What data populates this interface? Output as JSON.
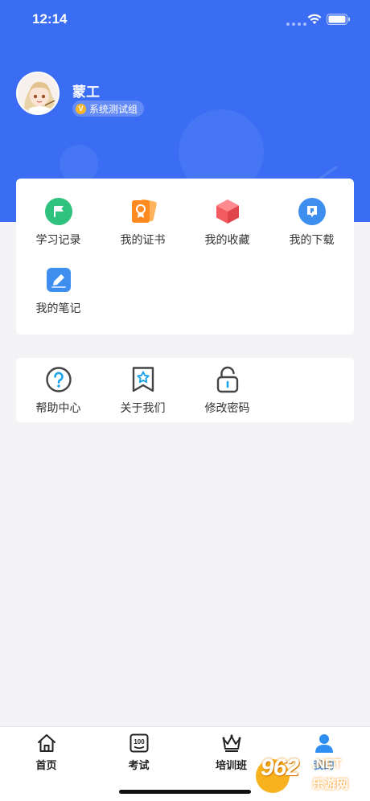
{
  "status_bar": {
    "time": "12:14"
  },
  "profile": {
    "name": "蒙工",
    "badge_icon_letter": "V",
    "badge_text": "系统测试组"
  },
  "shortcuts": [
    {
      "label": "学习记录",
      "icon": "flag-icon",
      "color": "#2ec27e"
    },
    {
      "label": "我的证书",
      "icon": "certificate-icon",
      "color": "#ff8a1f"
    },
    {
      "label": "我的收藏",
      "icon": "cube-icon",
      "color": "#f45b61"
    },
    {
      "label": "我的下载",
      "icon": "download-icon",
      "color": "#3e8ef0"
    },
    {
      "label": "我的笔记",
      "icon": "pencil-icon",
      "color": "#3e8ef0"
    }
  ],
  "services": [
    {
      "label": "帮助中心",
      "icon": "question-icon"
    },
    {
      "label": "关于我们",
      "icon": "bookmark-star-icon"
    },
    {
      "label": "修改密码",
      "icon": "unlock-icon"
    }
  ],
  "tabbar": {
    "items": [
      {
        "label": "首页",
        "icon": "home-icon"
      },
      {
        "label": "考试",
        "icon": "exam-100-icon"
      },
      {
        "label": "培训班",
        "icon": "crown-icon"
      },
      {
        "label": "我的",
        "icon": "person-icon",
        "active": true
      }
    ]
  },
  "watermark": {
    "brand": "962",
    "domain": ".NET",
    "sub": "乐游网"
  },
  "colors": {
    "primary": "#3a6cf4",
    "tab_active": "#2f8ef2"
  }
}
